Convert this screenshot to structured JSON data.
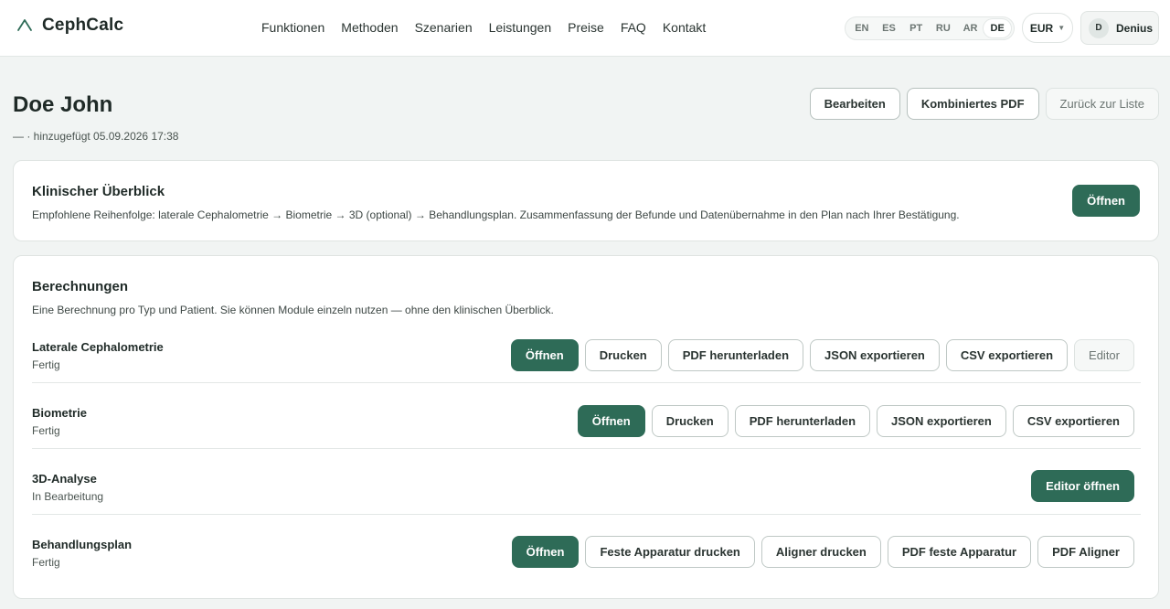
{
  "brand": {
    "name": "CephCalc"
  },
  "nav": [
    "Funktionen",
    "Methoden",
    "Szenarien",
    "Leistungen",
    "Preise",
    "FAQ",
    "Kontakt"
  ],
  "languages": {
    "items": [
      "EN",
      "ES",
      "PT",
      "RU",
      "AR",
      "DE"
    ],
    "active": "DE"
  },
  "currency": {
    "value": "EUR"
  },
  "user": {
    "initial": "D",
    "name": "Denius"
  },
  "patient": {
    "name": "Doe John",
    "meta": "— · hinzugefügt 05.09.2026 17:38",
    "actions": {
      "edit": "Bearbeiten",
      "combined_pdf": "Kombiniertes PDF",
      "back": "Zurück zur Liste"
    }
  },
  "overview": {
    "title": "Klinischer Überblick",
    "description": "Empfohlene Reihenfolge: laterale Cephalometrie → Biometrie → 3D (optional) → Behandlungsplan. Zusammenfassung der Befunde und Datenübernahme in den Plan nach Ihrer Bestätigung.",
    "open": "Öffnen"
  },
  "calculations": {
    "title": "Berechnungen",
    "description": "Eine Berechnung pro Typ und Patient. Sie können Module einzeln nutzen — ohne den klinischen Überblick.",
    "rows": [
      {
        "name": "Laterale Cephalometrie",
        "status": "Fertig",
        "actions": [
          "Öffnen",
          "Drucken",
          "PDF herunterladen",
          "JSON exportieren",
          "CSV exportieren",
          "Editor"
        ]
      },
      {
        "name": "Biometrie",
        "status": "Fertig",
        "actions": [
          "Öffnen",
          "Drucken",
          "PDF herunterladen",
          "JSON exportieren",
          "CSV exportieren"
        ]
      },
      {
        "name": "3D-Analyse",
        "status": "In Bearbeitung",
        "actions": [
          "Editor öffnen"
        ]
      },
      {
        "name": "Behandlungsplan",
        "status": "Fertig",
        "actions": [
          "Öffnen",
          "Feste Apparatur drucken",
          "Aligner drucken",
          "PDF feste Apparatur",
          "PDF Aligner"
        ]
      }
    ]
  },
  "colors": {
    "accent": "#2e6b57",
    "background": "#f1f4f3"
  }
}
